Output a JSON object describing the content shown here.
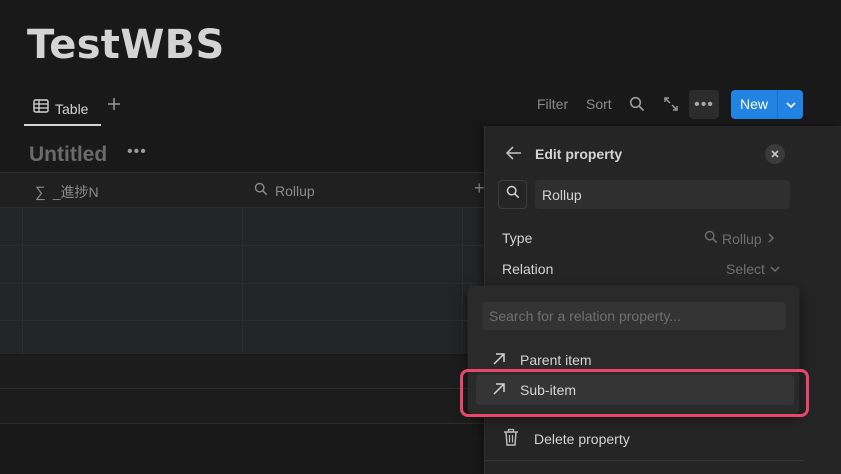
{
  "page": {
    "title": "TestWBS"
  },
  "view_tab": {
    "label": "Table"
  },
  "toolbar": {
    "filter": "Filter",
    "sort": "Sort",
    "new": "New"
  },
  "database": {
    "title": "Untitled"
  },
  "columns": [
    {
      "icon": "sigma",
      "label": "_進捗N"
    },
    {
      "icon": "search",
      "label": "Rollup"
    }
  ],
  "panel": {
    "title": "Edit property",
    "name_value": "Rollup",
    "type_label": "Type",
    "type_value": "Rollup",
    "relation_label": "Relation",
    "relation_value": "Select",
    "delete_label": "Delete property"
  },
  "dropdown": {
    "placeholder": "Search for a relation property...",
    "items": [
      {
        "label": "Parent item"
      },
      {
        "label": "Sub-item"
      }
    ]
  },
  "colors": {
    "accent": "#2383e2",
    "highlight": "#e8466c"
  }
}
